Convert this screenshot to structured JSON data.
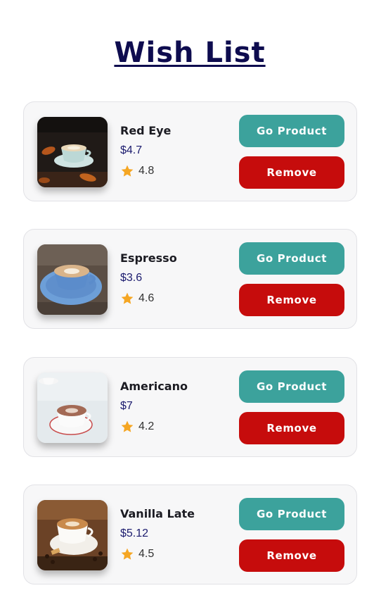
{
  "title": "Wish List",
  "items": [
    {
      "name": "Red Eye",
      "price": "$4.7",
      "rating": "4.8",
      "image": "red-eye-coffee-photo",
      "go_label": "Go Product",
      "remove_label": "Remove"
    },
    {
      "name": "Espresso",
      "price": "$3.6",
      "rating": "4.6",
      "image": "espresso-coffee-photo",
      "go_label": "Go Product",
      "remove_label": "Remove"
    },
    {
      "name": "Americano",
      "price": "$7",
      "rating": "4.2",
      "image": "americano-coffee-photo",
      "go_label": "Go Product",
      "remove_label": "Remove"
    },
    {
      "name": "Vanilla Late",
      "price": "$5.12",
      "rating": "4.5",
      "image": "vanilla-latte-coffee-photo",
      "go_label": "Go Product",
      "remove_label": "Remove"
    }
  ],
  "colors": {
    "title": "#0e0c4f",
    "go_button": "#3ca29c",
    "remove_button": "#c60c0c",
    "star": "#f5a623"
  }
}
